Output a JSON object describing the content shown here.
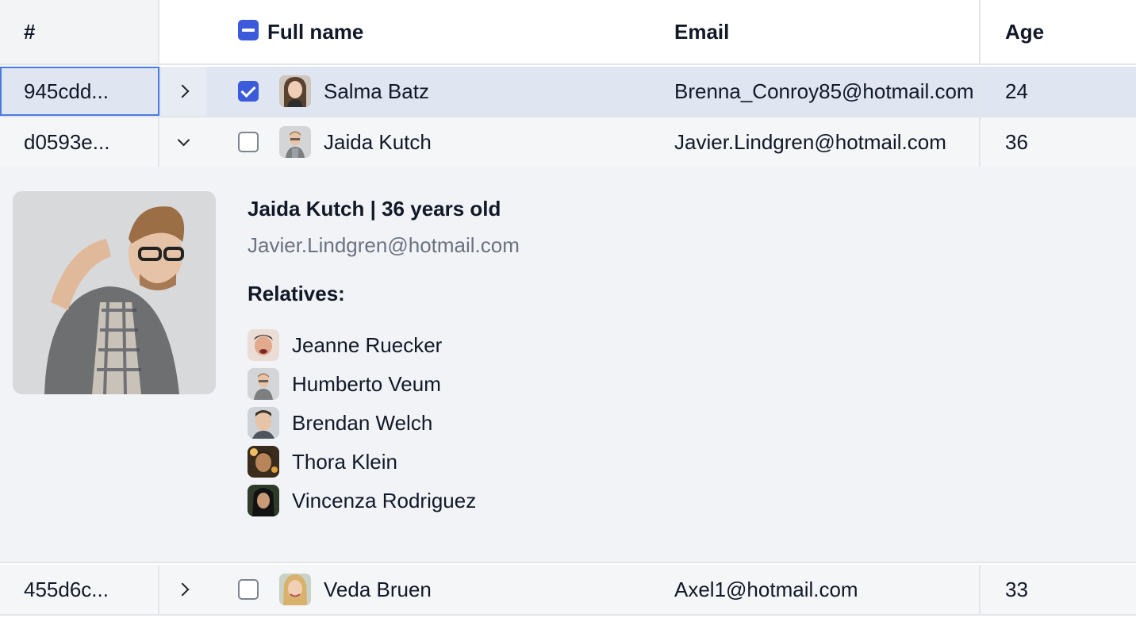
{
  "header": {
    "id_label": "#",
    "name_label": "Full name",
    "email_label": "Email",
    "age_label": "Age"
  },
  "rows": [
    {
      "id": "945cdd...",
      "name": "Salma Batz",
      "email": "Brenna_Conroy85@hotmail.com",
      "age": "24",
      "selected": true,
      "expanded": false
    },
    {
      "id": "d0593e...",
      "name": "Jaida Kutch",
      "email": "Javier.Lindgren@hotmail.com",
      "age": "36",
      "selected": false,
      "expanded": true
    },
    {
      "id": "455d6c...",
      "name": "Veda Bruen",
      "email": "Axel1@hotmail.com",
      "age": "33",
      "selected": false,
      "expanded": false
    }
  ],
  "detail": {
    "title": "Jaida Kutch | 36 years old",
    "email": "Javier.Lindgren@hotmail.com",
    "relatives_label": "Relatives:",
    "relatives": [
      {
        "name": "Jeanne Ruecker"
      },
      {
        "name": "Humberto Veum"
      },
      {
        "name": "Brendan Welch"
      },
      {
        "name": "Thora Klein"
      },
      {
        "name": "Vincenza Rodriguez"
      }
    ]
  },
  "colors": {
    "accent": "#3b5bdb",
    "selected_row": "#dfe5f1",
    "focus_border": "#4a7be0",
    "muted_text": "#6b7280"
  }
}
